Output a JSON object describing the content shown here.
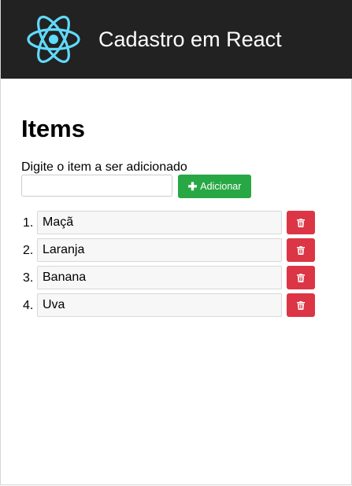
{
  "header": {
    "title": "Cadastro em React",
    "logo_icon": "react-atom-icon",
    "logo_color": "#61dafb",
    "background": "#222222"
  },
  "main": {
    "heading": "Items",
    "input_label": "Digite o item a ser adicionado",
    "input_value": "",
    "input_placeholder": "",
    "add_button": {
      "label": "Adicionar",
      "icon": "plus-icon",
      "color": "#28a745"
    },
    "items": [
      {
        "number": "1.",
        "value": "Maçã"
      },
      {
        "number": "2.",
        "value": "Laranja"
      },
      {
        "number": "3.",
        "value": "Banana"
      },
      {
        "number": "4.",
        "value": "Uva"
      }
    ],
    "delete_button": {
      "icon": "trash-icon",
      "color": "#dc3545"
    }
  }
}
